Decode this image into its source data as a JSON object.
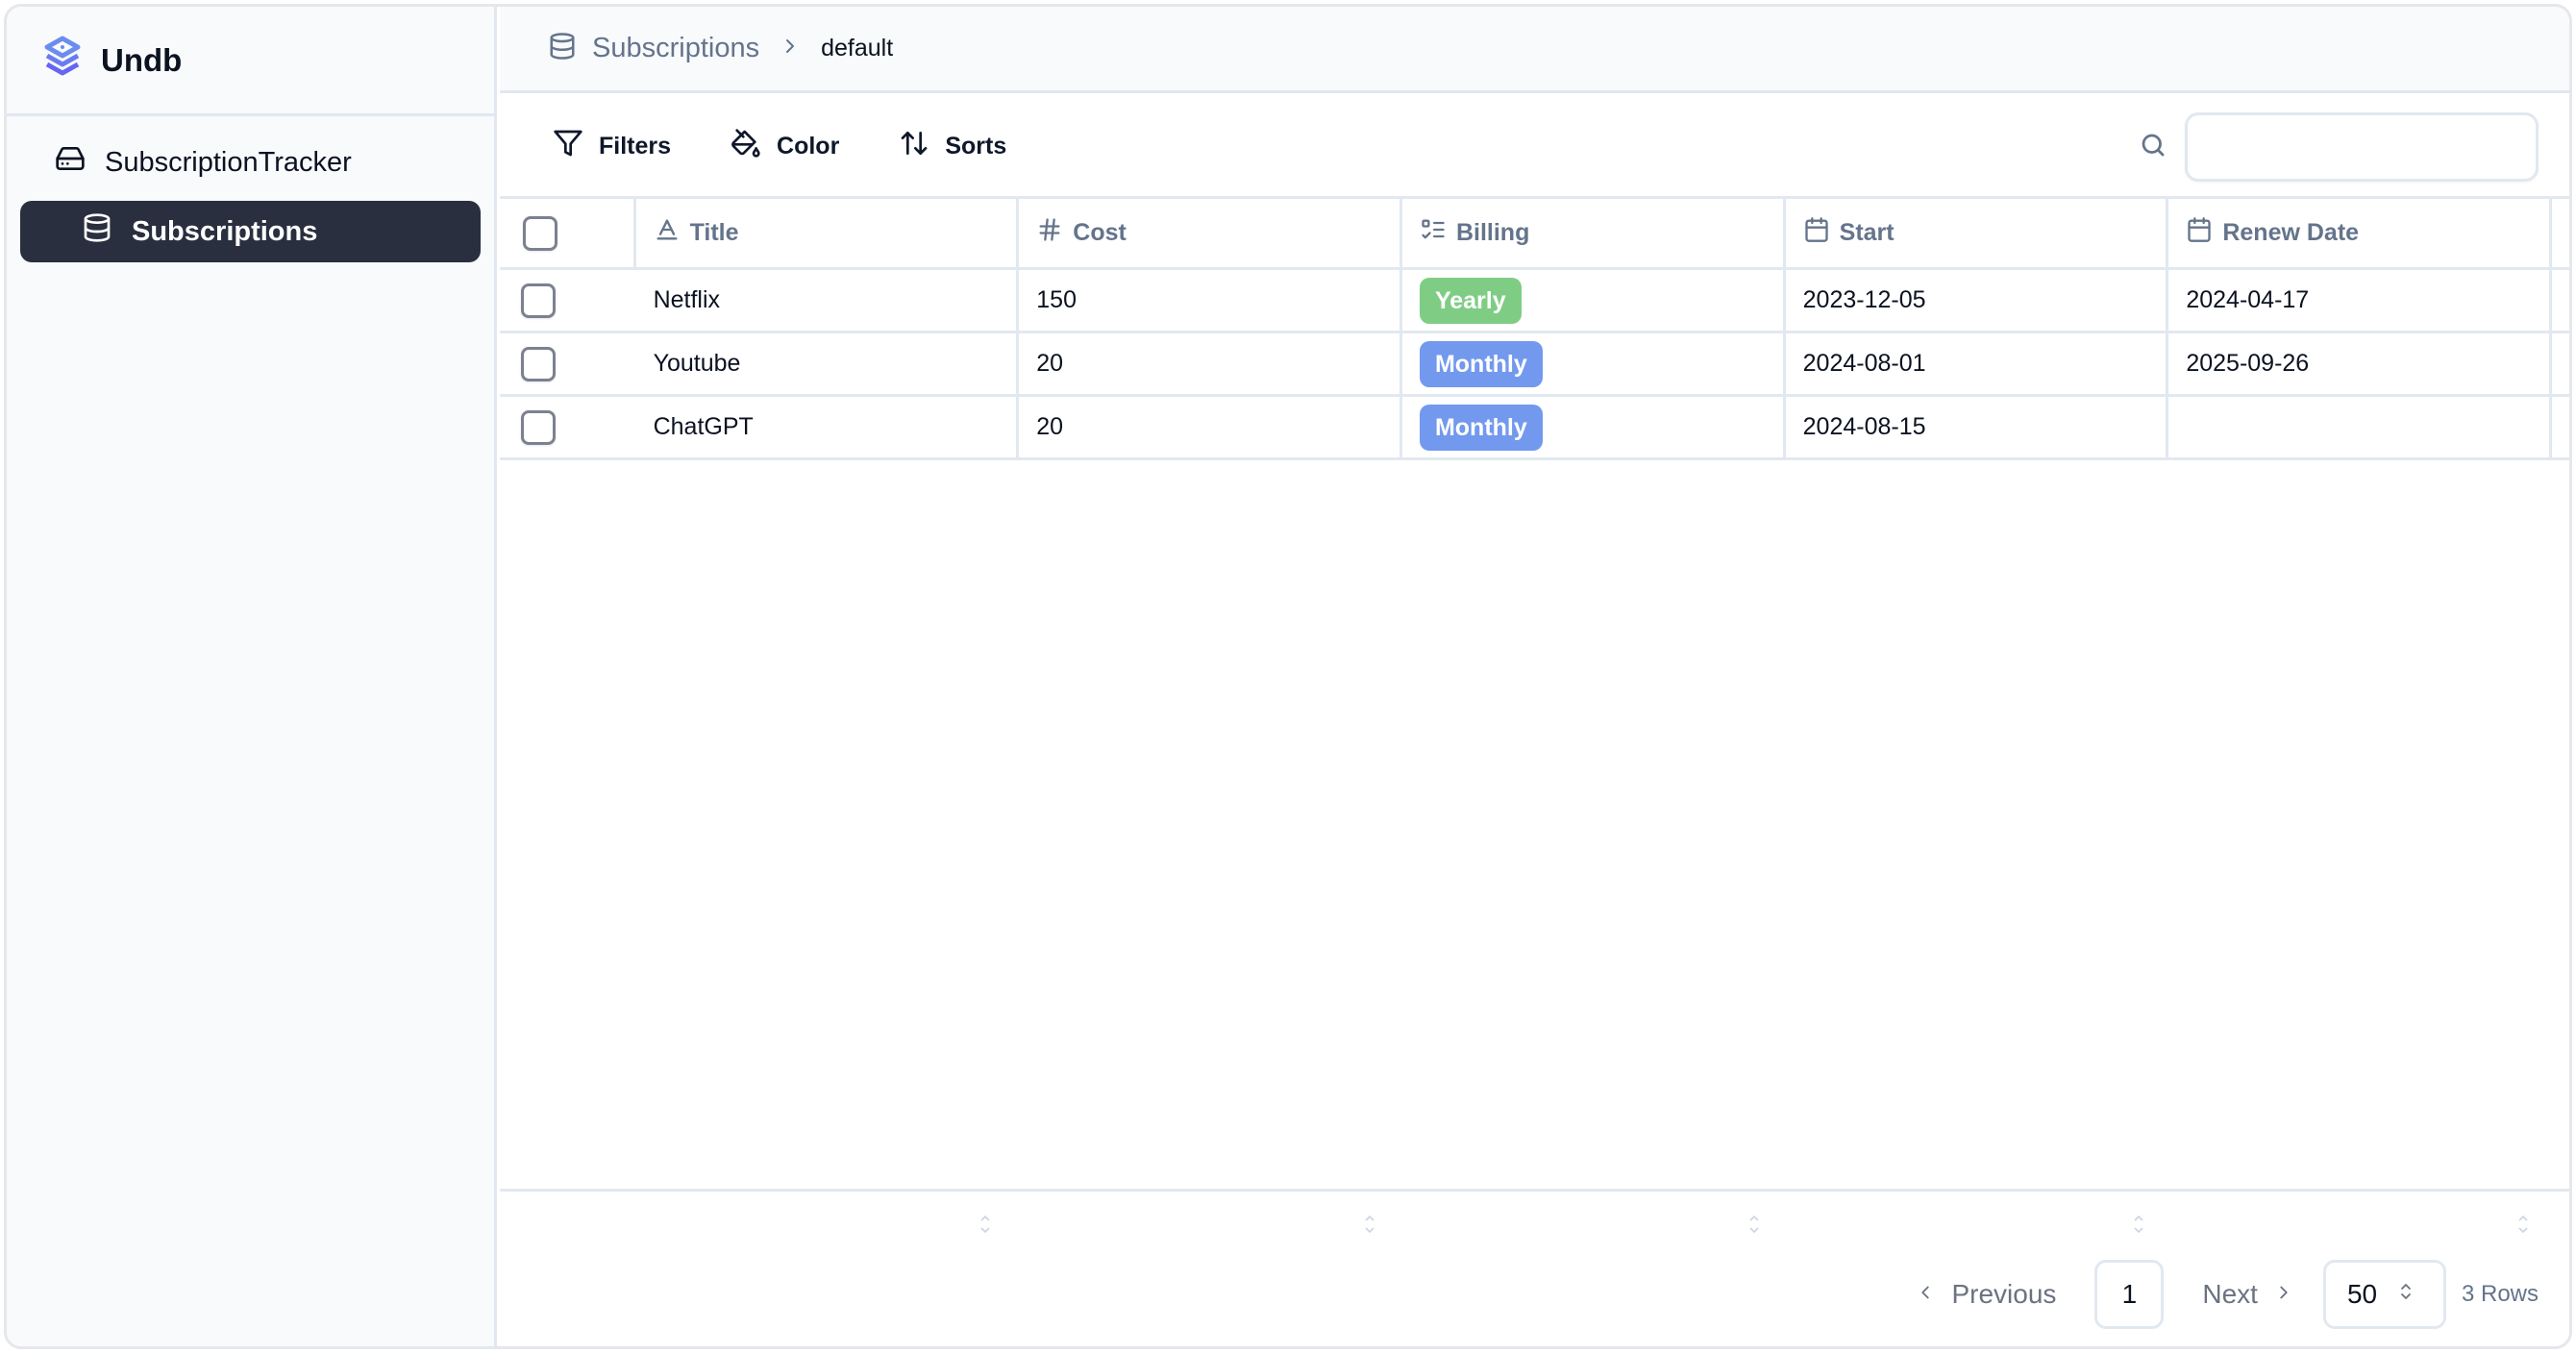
{
  "app": {
    "name": "Undb",
    "logo_icon": "stacked-layers-logo"
  },
  "sidebar": {
    "base": {
      "label": "SubscriptionTracker",
      "icon": "hard-drive-icon"
    },
    "tables": [
      {
        "label": "Subscriptions",
        "icon": "database-icon",
        "active": true
      }
    ]
  },
  "breadcrumb": {
    "table": "Subscriptions",
    "view": "default"
  },
  "toolbar": {
    "filters_label": "Filters",
    "color_label": "Color",
    "sorts_label": "Sorts",
    "search_value": "",
    "search_placeholder": ""
  },
  "table": {
    "columns": [
      {
        "label": "Title",
        "icon": "text-type-icon"
      },
      {
        "label": "Cost",
        "icon": "hash-icon"
      },
      {
        "label": "Billing",
        "icon": "list-checks-icon"
      },
      {
        "label": "Start",
        "icon": "calendar-icon"
      },
      {
        "label": "Renew Date",
        "icon": "calendar-icon"
      }
    ],
    "rows": [
      {
        "title": "Netflix",
        "cost": "150",
        "billing": "Yearly",
        "start": "2023-12-05",
        "renew": "2024-04-17"
      },
      {
        "title": "Youtube",
        "cost": "20",
        "billing": "Monthly",
        "start": "2024-08-01",
        "renew": "2025-09-26"
      },
      {
        "title": "ChatGPT",
        "cost": "20",
        "billing": "Monthly",
        "start": "2024-08-15",
        "renew": ""
      }
    ],
    "billing_colors": {
      "Yearly": "#7fcd85",
      "Monthly": "#7399ee"
    }
  },
  "pagination": {
    "previous_label": "Previous",
    "next_label": "Next",
    "current_page": "1",
    "page_size": "50",
    "row_count": "3 Rows"
  }
}
